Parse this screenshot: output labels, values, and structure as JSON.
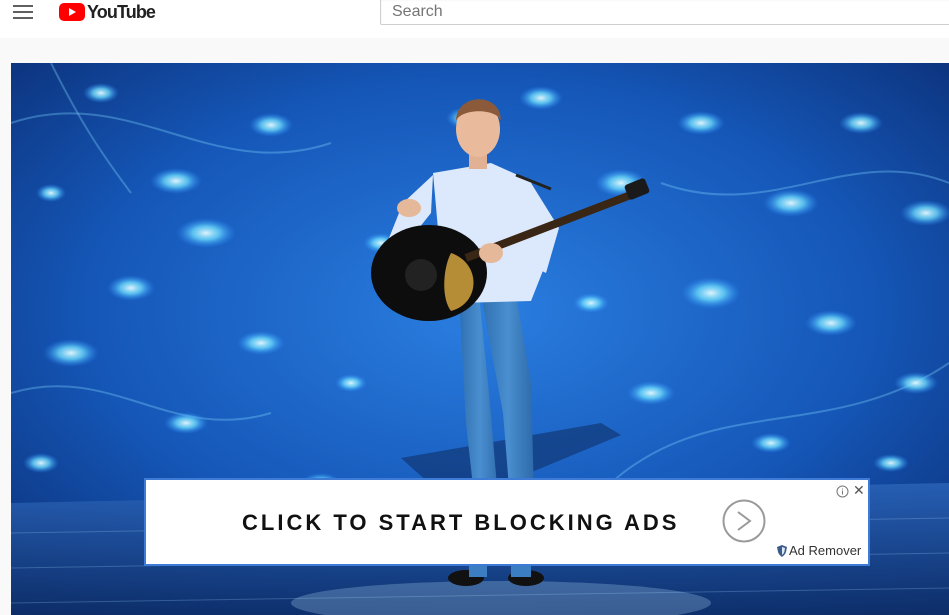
{
  "header": {
    "logo_text": "YouTube",
    "search_placeholder": "Search"
  },
  "ad": {
    "cta_text": "CLICK TO START BLOCKING ADS",
    "brand": "Ad Remover",
    "close_glyph": "✕"
  },
  "colors": {
    "youtube_red": "#ff0000",
    "ad_border": "#3d7bd6",
    "stage_blue": "#1a5fc4"
  },
  "icons": [
    "menu-icon",
    "youtube-logo-icon",
    "play-arrow-icon",
    "info-icon",
    "close-icon",
    "shield-icon"
  ]
}
